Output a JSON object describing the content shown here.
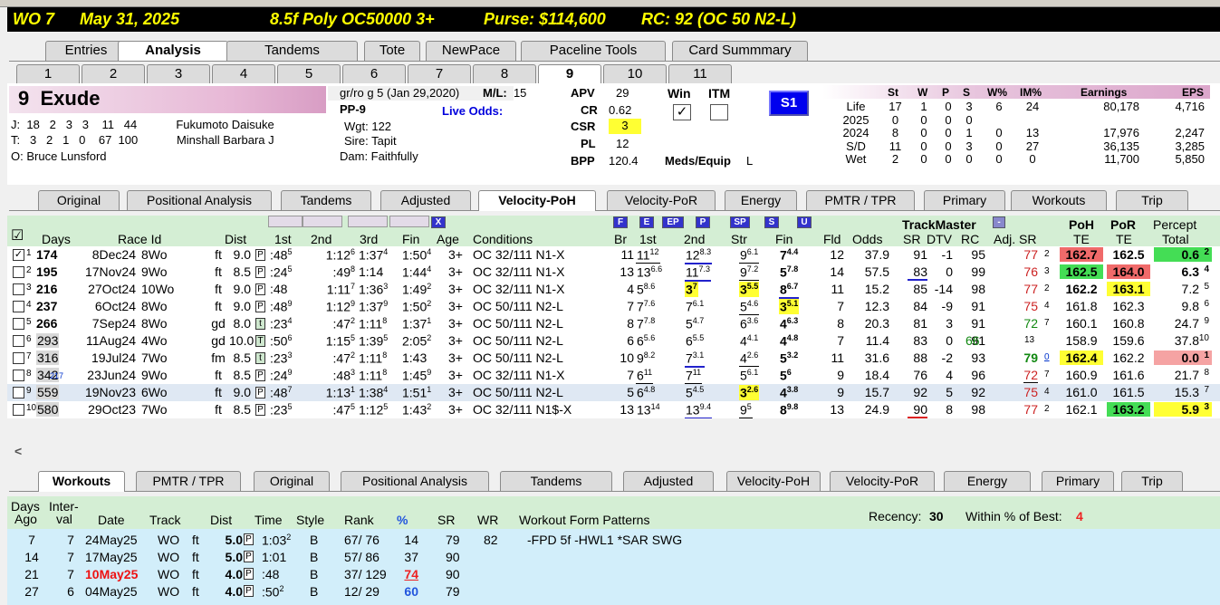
{
  "title_bar": {
    "track_race": "WO  7",
    "date": "May 31, 2025",
    "race_type": "8.5f  Poly  OC50000  3+",
    "purse": "Purse: $114,600",
    "rc": "RC: 92  (OC 50 N2-L)"
  },
  "main_tabs": [
    "Entries",
    "Analysis",
    "Tandems",
    "Tote",
    "NewPace",
    "Paceline Tools",
    "Card Summmary"
  ],
  "main_tab_active": "Analysis",
  "horse_tabs": [
    "1",
    "2",
    "3",
    "4",
    "5",
    "6",
    "7",
    "8",
    "9",
    "10",
    "11"
  ],
  "horse_tab_active": "9",
  "horse": {
    "program": "9",
    "name": "Exude",
    "jockey_label": "J:",
    "jockey_stats": "18   2   3   3    11   44",
    "jockey": "Fukumoto Daisuke",
    "trainer_label": "T:",
    "trainer_stats": "3   2   1   0    67  100",
    "trainer": "Minshall Barbara J",
    "owner": "O: Bruce Lunsford",
    "description": "gr/ro g 5 (Jan 29,2020)",
    "ml_label": "M/L:",
    "ml": "15",
    "pp": "PP-9",
    "live_odds_label": "Live Odds:",
    "wgt": "Wgt: 122",
    "sire": "Sire: Tapit",
    "dam": "Dam: Faithfully",
    "apv_label": "APV",
    "apv": "29",
    "cr_label": "CR",
    "cr": "0.62",
    "csr_label": "CSR",
    "csr": "3",
    "pl_label": "PL",
    "pl": "12",
    "bpp_label": "BPP",
    "bpp": "120.4",
    "win_label": "Win",
    "itm_label": "ITM",
    "win_check": "✓",
    "meds_label": "Meds/Equip",
    "meds": "L",
    "s1": "S1"
  },
  "stats": {
    "headers": [
      "St",
      "W",
      "P",
      "S",
      "W%",
      "IM%",
      "Earnings",
      "EPS"
    ],
    "rows": [
      {
        "label": "Life",
        "st": "17",
        "w": "1",
        "p": "0",
        "s": "3",
        "wp": "6",
        "im": "24",
        "earn": "80,178",
        "eps": "4,716"
      },
      {
        "label": "2025",
        "st": "0",
        "w": "0",
        "p": "0",
        "s": "0",
        "wp": "",
        "im": "",
        "earn": "",
        "eps": ""
      },
      {
        "label": "2024",
        "st": "8",
        "w": "0",
        "p": "0",
        "s": "1",
        "wp": "0",
        "im": "13",
        "earn": "17,976",
        "eps": "2,247"
      },
      {
        "label": "S/D",
        "st": "11",
        "w": "0",
        "p": "0",
        "s": "3",
        "wp": "0",
        "im": "27",
        "earn": "36,135",
        "eps": "3,285"
      },
      {
        "label": "Wet",
        "st": "2",
        "w": "0",
        "p": "0",
        "s": "0",
        "wp": "0",
        "im": "0",
        "earn": "11,700",
        "eps": "5,850"
      }
    ]
  },
  "analysis_tabs": [
    "Original",
    "Positional Analysis",
    "Tandems",
    "Adjusted",
    "Velocity-PoH",
    "Velocity-PoR",
    "Energy",
    "PMTR / TPR",
    "Primary",
    "Workouts",
    "Trip"
  ],
  "analysis_tab_active": "Velocity-PoH",
  "pp_header": {
    "check": "☑",
    "days": "Days",
    "race_id": "Race Id",
    "dist": "Dist",
    "c1": "1st",
    "c2": "2nd",
    "c3": "3rd",
    "fin": "Fin",
    "age": "Age",
    "conditions": "Conditions",
    "br": "Br",
    "v1": "1st",
    "v2": "2nd",
    "str": "Str",
    "vfin": "Fin",
    "fld": "Fld",
    "odds": "Odds",
    "trackmaster": "TrackMaster",
    "sr": "SR",
    "dtv": "DTV",
    "rc": "RC",
    "adjsr": "Adj. SR",
    "poh": "PoH",
    "poh2": "TE",
    "por": "PoR",
    "por2": "TE",
    "pct": "Percept",
    "pct2": "Total",
    "btn_x": "X",
    "btn_f": "F",
    "btn_e": "E",
    "btn_ep": "EP",
    "btn_p": "P",
    "btn_sp": "SP",
    "btn_s": "S",
    "btn_u": "U",
    "btn_minus": "-"
  },
  "pp_rows": [
    {
      "n": "1",
      "chk": "✓",
      "days": "174",
      "dsup": "7",
      "date": "8Dec24",
      "race": "8Wo",
      "surf": "ft",
      "dist": "9.0",
      "sb": "P",
      "c1": ":48",
      "c1s": "5",
      "c2": "1:12",
      "c2s": "6",
      "c3": "1:37",
      "c3s": "4",
      "fin": "1:50",
      "fins": "4",
      "age": "3+",
      "cond": "OC 32/111 N1-X",
      "br": "11",
      "v1": "11",
      "v1s": "12",
      "v2": "12",
      "v2s": "8.3",
      "str": "9",
      "strs": "6.1",
      "vf": "7",
      "vfs": "4.4",
      "fld": "12",
      "odds": "37.9",
      "sr": "91",
      "dtv": "-1",
      "rc": "95",
      "adj": "77",
      "adjs": "2",
      "poh": "162.7",
      "por": "162.5",
      "pct": "0.6",
      "pcts": "2"
    },
    {
      "n": "2",
      "chk": "",
      "days": "195",
      "dsup": "",
      "date": "17Nov24",
      "race": "9Wo",
      "surf": "ft",
      "dist": "8.5",
      "sb": "P",
      "c1": ":24",
      "c1s": "5",
      "c2": ":49",
      "c2s": "8",
      "c3": "1:14",
      "c3s": "",
      "fin": "1:44",
      "fins": "4",
      "age": "3+",
      "cond": "OC 32/111 N1-X",
      "br": "13",
      "v1": "13",
      "v1s": "6.6",
      "v2": "11",
      "v2s": "7.3",
      "str": "9",
      "strs": "7.2",
      "vf": "5",
      "vfs": "7.8",
      "fld": "14",
      "odds": "57.5",
      "sr": "83",
      "dtv": "0",
      "rc": "99",
      "adj": "76",
      "adjs": "3",
      "poh": "162.5",
      "por": "164.0",
      "pct": "6.3",
      "pcts": "4"
    },
    {
      "n": "3",
      "chk": "",
      "days": "216",
      "dsup": "",
      "date": "27Oct24",
      "race": "10Wo",
      "surf": "ft",
      "dist": "9.0",
      "sb": "P",
      "c1": ":48",
      "c1s": "",
      "c2": "1:11",
      "c2s": "7",
      "c3": "1:36",
      "c3s": "3",
      "fin": "1:49",
      "fins": "2",
      "age": "3+",
      "cond": "OC 32/111 N1-X",
      "br": "4",
      "v1": "5",
      "v1s": "8.6",
      "v2": "3",
      "v2s": "7",
      "str": "3",
      "strs": "5.5",
      "vf": "8",
      "vfs": "6.7",
      "fld": "11",
      "odds": "15.2",
      "sr": "85",
      "dtv": "-14",
      "rc": "98",
      "adj": "77",
      "adjs": "2",
      "poh": "162.2",
      "por": "163.1",
      "pct": "7.2",
      "pcts": "5"
    },
    {
      "n": "4",
      "chk": "",
      "days": "237",
      "dsup": "",
      "date": "6Oct24",
      "race": "8Wo",
      "surf": "ft",
      "dist": "9.0",
      "sb": "P",
      "c1": ":48",
      "c1s": "9",
      "c2": "1:12",
      "c2s": "9",
      "c3": "1:37",
      "c3s": "9",
      "fin": "1:50",
      "fins": "2",
      "age": "3+",
      "cond": "OC 50/111 N2-L",
      "br": "7",
      "v1": "7",
      "v1s": "7.6",
      "v2": "7",
      "v2s": "6.1",
      "str": "5",
      "strs": "4.6",
      "vf": "3",
      "vfs": "5.1",
      "fld": "7",
      "odds": "12.3",
      "sr": "84",
      "dtv": "-9",
      "rc": "91",
      "adj": "75",
      "adjs": "4",
      "poh": "161.8",
      "por": "162.3",
      "pct": "9.8",
      "pcts": "6"
    },
    {
      "n": "5",
      "chk": "",
      "days": "266",
      "dsup": "",
      "date": "7Sep24",
      "race": "8Wo",
      "surf": "gd",
      "dist": "8.0",
      "sb": "t",
      "c1": ":23",
      "c1s": "4",
      "c2": ":47",
      "c2s": "2",
      "c3": "1:11",
      "c3s": "8",
      "fin": "1:37",
      "fins": "1",
      "age": "3+",
      "cond": "OC 50/111 N2-L",
      "br": "8",
      "v1": "7",
      "v1s": "7.8",
      "v2": "5",
      "v2s": "4.7",
      "str": "6",
      "strs": "3.6",
      "vf": "4",
      "vfs": "6.3",
      "fld": "8",
      "odds": "20.3",
      "sr": "81",
      "dtv": "3",
      "rc": "91",
      "adj": "72",
      "adjs": "7",
      "poh": "160.1",
      "por": "160.8",
      "pct": "24.7",
      "pcts": "9"
    },
    {
      "n": "6",
      "chk": "",
      "days": "293",
      "dsup": "",
      "date": "11Aug24",
      "race": "4Wo",
      "surf": "gd",
      "dist": "10.0",
      "sb": "T",
      "c1": ":50",
      "c1s": "6",
      "c2": "1:15",
      "c2s": "5",
      "c3": "1:39",
      "c3s": "5",
      "fin": "2:05",
      "fins": "2",
      "age": "3+",
      "cond": "OC 50/111 N2-L",
      "br": "6",
      "v1": "6",
      "v1s": "5.6",
      "v2": "6",
      "v2s": "5.5",
      "str": "4",
      "strs": "4.1",
      "vf": "4",
      "vfs": "4.8",
      "fld": "7",
      "odds": "11.4",
      "sr": "83",
      "dtv": "0",
      "rc": "91",
      "adj": "66",
      "adjs": "13",
      "poh": "158.9",
      "por": "159.6",
      "pct": "37.8",
      "pcts": "10"
    },
    {
      "n": "7",
      "chk": "",
      "days": "316",
      "dsup": "",
      "date": "19Jul24",
      "race": "7Wo",
      "surf": "fm",
      "dist": "8.5",
      "sb": "t",
      "c1": ":23",
      "c1s": "3",
      "c2": ":47",
      "c2s": "2",
      "c3": "1:11",
      "c3s": "8",
      "fin": "1:43",
      "fins": "",
      "age": "3+",
      "cond": "OC 50/111 N2-L",
      "br": "10",
      "v1": "9",
      "v1s": "8.2",
      "v2": "7",
      "v2s": "3.1",
      "str": "4",
      "strs": "2.6",
      "vf": "5",
      "vfs": "3.2",
      "fld": "11",
      "odds": "31.6",
      "sr": "88",
      "dtv": "-2",
      "rc": "93",
      "adj": "79",
      "adjs": "0",
      "poh": "162.4",
      "por": "162.2",
      "pct": "0.0",
      "pcts": "1"
    },
    {
      "n": "8",
      "chk": "",
      "days": "342",
      "dsup": "217",
      "date": "23Jun24",
      "race": "9Wo",
      "surf": "ft",
      "dist": "8.5",
      "sb": "P",
      "c1": ":24",
      "c1s": "9",
      "c2": ":48",
      "c2s": "3",
      "c3": "1:11",
      "c3s": "8",
      "fin": "1:45",
      "fins": "9",
      "age": "3+",
      "cond": "OC 32/111 N1-X",
      "br": "7",
      "v1": "6",
      "v1s": "11",
      "v2": "7",
      "v2s": "11",
      "str": "5",
      "strs": "6.1",
      "vf": "5",
      "vfs": "6",
      "fld": "9",
      "odds": "18.4",
      "sr": "76",
      "dtv": "4",
      "rc": "96",
      "adj": "72",
      "adjs": "7",
      "poh": "160.9",
      "por": "161.6",
      "pct": "21.7",
      "pcts": "8"
    },
    {
      "n": "9",
      "chk": "",
      "days": "559",
      "dsup": "",
      "date": "19Nov23",
      "race": "6Wo",
      "surf": "ft",
      "dist": "9.0",
      "sb": "P",
      "c1": ":48",
      "c1s": "7",
      "c2": "1:13",
      "c2s": "1",
      "c3": "1:38",
      "c3s": "4",
      "fin": "1:51",
      "fins": "1",
      "age": "3+",
      "cond": "OC 50/111 N2-L",
      "br": "5",
      "v1": "6",
      "v1s": "4.8",
      "v2": "5",
      "v2s": "4.5",
      "str": "3",
      "strs": "2.6",
      "vf": "4",
      "vfs": "3.8",
      "fld": "9",
      "odds": "15.7",
      "sr": "92",
      "dtv": "5",
      "rc": "92",
      "adj": "75",
      "adjs": "4",
      "poh": "161.0",
      "por": "161.5",
      "pct": "15.3",
      "pcts": "7"
    },
    {
      "n": "10",
      "chk": "",
      "days": "580",
      "dsup": "",
      "date": "29Oct23",
      "race": "7Wo",
      "surf": "ft",
      "dist": "8.5",
      "sb": "P",
      "c1": ":23",
      "c1s": "5",
      "c2": ":47",
      "c2s": "5",
      "c3": "1:12",
      "c3s": "5",
      "fin": "1:43",
      "fins": "2",
      "age": "3+",
      "cond": "OC 32/111 N1$-X",
      "br": "13",
      "v1": "13",
      "v1s": "14",
      "v2": "13",
      "v2s": "9.4",
      "str": "9",
      "strs": "5",
      "vf": "8",
      "vfs": "9.8",
      "fld": "13",
      "odds": "24.9",
      "sr": "90",
      "dtv": "8",
      "rc": "98",
      "adj": "77",
      "adjs": "2",
      "poh": "162.1",
      "por": "163.2",
      "pct": "5.9",
      "pcts": "3"
    }
  ],
  "scroll_arrow": "<",
  "lower_tabs": [
    "Workouts",
    "PMTR / TPR",
    "Original",
    "Positional Analysis",
    "Tandems",
    "Adjusted",
    "Velocity-PoH",
    "Velocity-PoR",
    "Energy",
    "Primary",
    "Trip"
  ],
  "lower_tab_active": "Workouts",
  "wo_header": {
    "days1": "Days",
    "days2": "Ago",
    "int1": "Inter-",
    "int2": "val",
    "date": "Date",
    "track": "Track",
    "dist": "Dist",
    "time": "Time",
    "style": "Style",
    "rank": "Rank",
    "pct": "%",
    "sr": "SR",
    "wr": "WR",
    "patterns": "Workout Form Patterns",
    "recency_label": "Recency:",
    "recency": "30",
    "within_label": "Within % of Best:",
    "within": "4"
  },
  "wo_rows": [
    {
      "ago": "7",
      "int": "7",
      "date": "24May25",
      "track": "WO",
      "surf": "ft",
      "dist": "5.0",
      "sb": "P",
      "time": "1:03",
      "ts": "2",
      "style": "B",
      "rank": "67/ 76",
      "pct": "14",
      "sr": "79",
      "wr": "82",
      "pattern": "-FPD  5f  -HWL1  *SAR  SWG"
    },
    {
      "ago": "14",
      "int": "7",
      "date": "17May25",
      "track": "WO",
      "surf": "ft",
      "dist": "5.0",
      "sb": "P",
      "time": "1:01",
      "ts": "",
      "style": "B",
      "rank": "57/ 86",
      "pct": "37",
      "sr": "90",
      "wr": "",
      "pattern": ""
    },
    {
      "ago": "21",
      "int": "7",
      "date": "10May25",
      "track": "WO",
      "surf": "ft",
      "dist": "4.0",
      "sb": "P",
      "time": ":48",
      "ts": "",
      "style": "B",
      "rank": "37/ 129",
      "pct": "74",
      "sr": "90",
      "wr": "",
      "pattern": ""
    },
    {
      "ago": "27",
      "int": "6",
      "date": "04May25",
      "track": "WO",
      "surf": "ft",
      "dist": "4.0",
      "sb": "P",
      "time": ":50",
      "ts": "2",
      "style": "B",
      "rank": "12/ 29",
      "pct": "60",
      "sr": "79",
      "wr": "",
      "pattern": ""
    }
  ]
}
